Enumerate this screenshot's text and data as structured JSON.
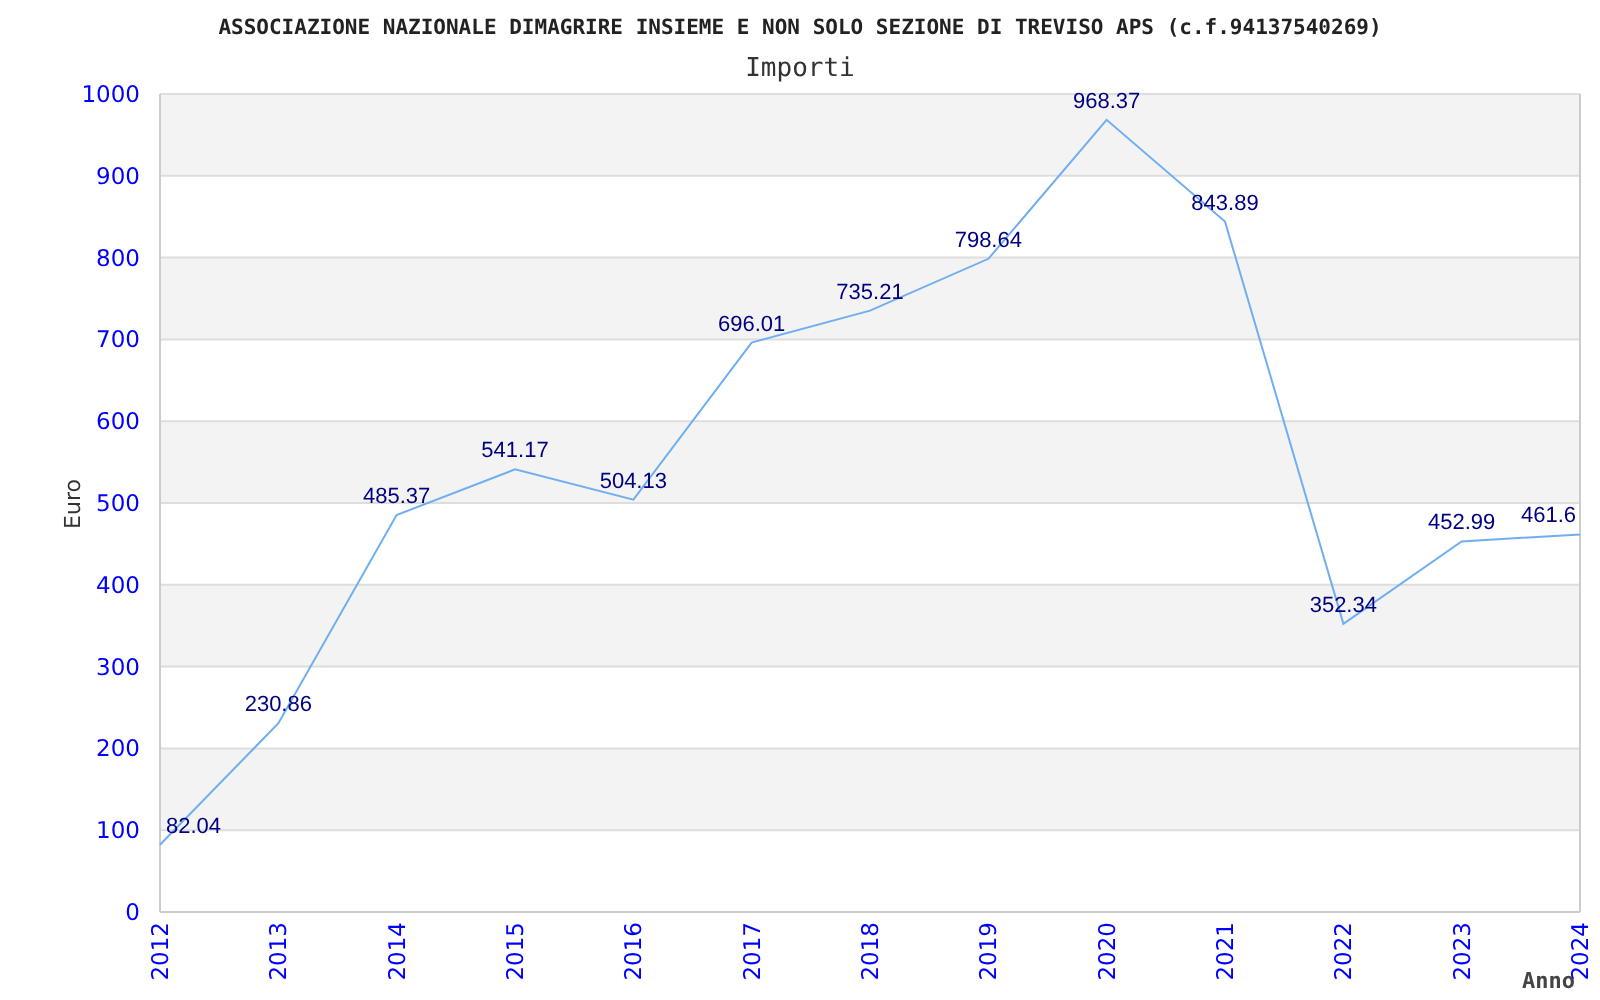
{
  "header": {
    "title": "ASSOCIAZIONE NAZIONALE DIMAGRIRE INSIEME E NON SOLO SEZIONE DI TREVISO APS (c.f.94137540269)"
  },
  "chart": {
    "chart_data": {
      "type": "line",
      "title": "Importi",
      "xlabel": "Anno",
      "ylabel": "Euro",
      "categories": [
        "2012",
        "2013",
        "2014",
        "2015",
        "2016",
        "2017",
        "2018",
        "2019",
        "2020",
        "2021",
        "2022",
        "2023",
        "2024"
      ],
      "series": [
        {
          "color": "#70aef0",
          "values": [
            82.04,
            230.86,
            485.37,
            541.17,
            504.13,
            696.01,
            735.21,
            798.64,
            968.37,
            843.89,
            352.34,
            452.99,
            461.6
          ]
        }
      ],
      "ylim": [
        0,
        1000
      ],
      "yticks": [
        0,
        100,
        200,
        300,
        400,
        500,
        600,
        700,
        800,
        900,
        1000
      ],
      "data_labels": true,
      "grid": true
    }
  }
}
